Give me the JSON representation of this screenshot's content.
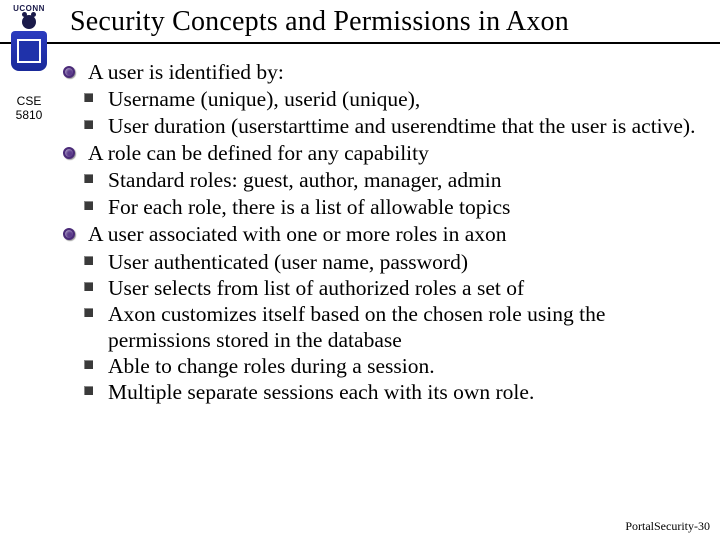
{
  "header": {
    "logo_wordmark": "UCONN",
    "title": "Security Concepts and Permissions in Axon"
  },
  "sidebar": {
    "course_line1": "CSE",
    "course_line2": "5810"
  },
  "bullets": [
    {
      "text": "A user is identified by:",
      "subs": [
        "Username (unique), userid (unique),",
        "User duration (userstarttime and userendtime that the user is active)."
      ]
    },
    {
      "text": "A role can be defined for any capability",
      "subs": [
        "Standard roles: guest, author, manager, admin",
        "For each role, there is a list of allowable topics"
      ]
    },
    {
      "text": "A user associated with one or more roles in axon",
      "subs": [
        "User authenticated (user name, password)",
        "User selects from list of authorized roles a set of",
        "Axon customizes itself based on the chosen role using the permissions stored in the database",
        "Able to change roles during a session.",
        "Multiple separate sessions each with its own role."
      ]
    }
  ],
  "footer": {
    "text": "PortalSecurity-30"
  }
}
